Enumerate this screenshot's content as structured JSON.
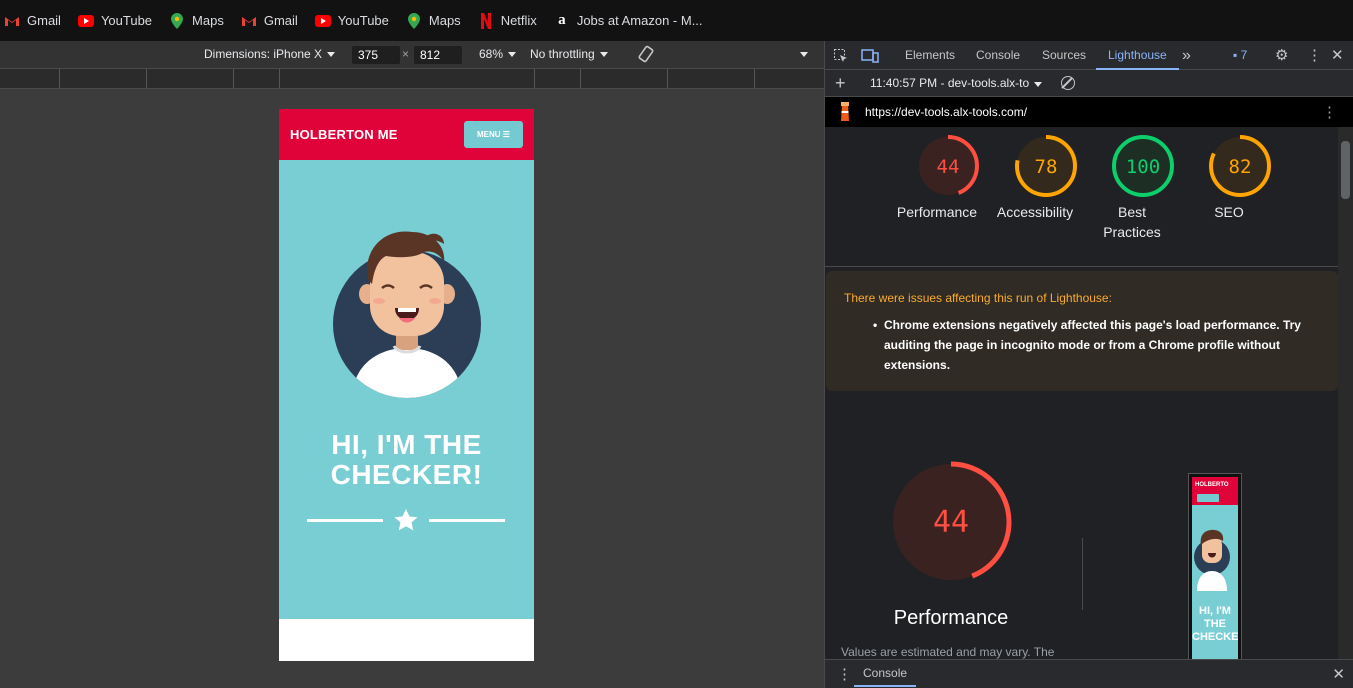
{
  "bookmarks": [
    {
      "label": "Gmail",
      "icon": "gmail-icon"
    },
    {
      "label": "YouTube",
      "icon": "youtube-icon"
    },
    {
      "label": "Maps",
      "icon": "maps-icon"
    },
    {
      "label": "Gmail",
      "icon": "gmail-icon"
    },
    {
      "label": "YouTube",
      "icon": "youtube-icon"
    },
    {
      "label": "Maps",
      "icon": "maps-icon"
    },
    {
      "label": "Netflix",
      "icon": "netflix-icon"
    },
    {
      "label": "Jobs at Amazon - M...",
      "icon": "amazon-icon"
    }
  ],
  "device_toolbar": {
    "dimensions": "Dimensions: iPhone X",
    "width": "375",
    "times": "×",
    "height": "812",
    "zoom": "68%",
    "throttling": "No throttling"
  },
  "phone": {
    "brand": "HOLBERTON ME",
    "menu": "MENU ☰",
    "title_line1": "HI, I'M THE",
    "title_line2": "CHECKER!"
  },
  "devtools": {
    "tabs": [
      "Elements",
      "Console",
      "Sources",
      "Lighthouse"
    ],
    "more": "»",
    "badge_count": "7",
    "timestamp": "11:40:57 PM - dev-tools.alx-to",
    "url": "https://dev-tools.alx-tools.com/"
  },
  "scores": [
    {
      "label": "Performance",
      "value": 44,
      "color": "#ff4e42"
    },
    {
      "label": "Accessibility",
      "value": 78,
      "color": "#ffa400"
    },
    {
      "label": "Best Practices",
      "value": 100,
      "color": "#0cce6b"
    },
    {
      "label": "SEO",
      "value": 82,
      "color": "#ffa400"
    }
  ],
  "warning": {
    "title": "There were issues affecting this run of Lighthouse:",
    "item": "Chrome extensions negatively affected this page's load performance. Try auditing the page in incognito mode or from a Chrome profile without extensions."
  },
  "big_score": {
    "value": "44",
    "label": "Performance",
    "note": "Values are estimated and may vary. The"
  },
  "console_drawer": {
    "label": "Console"
  },
  "thumb": {
    "brand": "HOLBERTO",
    "line1": "HI, I'M",
    "line2": "THE",
    "line3": "CHECKE"
  }
}
